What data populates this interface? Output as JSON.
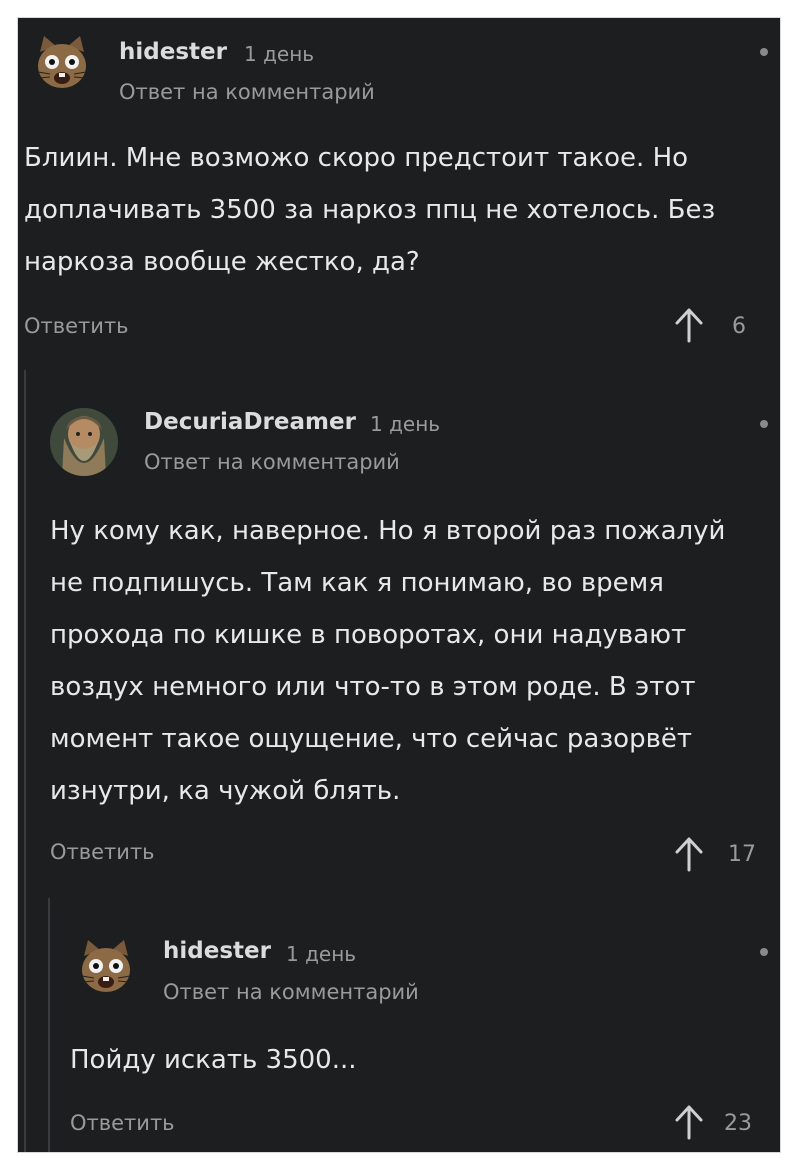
{
  "comments": [
    {
      "username": "hidester",
      "time": "1 день",
      "reply_label": "Ответ на комментарий",
      "lines": [
        "Блиин. Мне возможо скоро предстоит такое. Но",
        "доплачивать 3500 за наркоз ппц не хотелось. Без",
        "наркоза вообще жестко, да?"
      ],
      "reply_button": "Ответить",
      "upvotes": "6",
      "avatar_icon": "cat-avatar-icon"
    },
    {
      "username": "DecuriaDreamer",
      "time": "1 день",
      "reply_label": "Ответ на комментарий",
      "lines": [
        "Ну кому как, наверное. Но я второй раз пожалуй",
        "не подпишусь. Там как я понимаю, во время",
        "прохода по кишке в поворотах, они надувают",
        "воздух немного или что-то в этом роде. В этот",
        "момент такое ощущение, что сейчас разорвёт",
        "изнутри, ка чужой блять."
      ],
      "reply_button": "Ответить",
      "upvotes": "17",
      "avatar_icon": "bearded-man-avatar-icon"
    },
    {
      "username": "hidester",
      "time": "1 день",
      "reply_label": "Ответ на комментарий",
      "lines": [
        "Пойду искать 3500..."
      ],
      "reply_button": "Ответить",
      "upvotes": "23",
      "avatar_icon": "cat-avatar-icon"
    }
  ],
  "colors": {
    "background": "#1d1e20",
    "text": "#e8e8e8",
    "muted": "#9a9a9a",
    "thread_line": "#3a3b3e"
  }
}
